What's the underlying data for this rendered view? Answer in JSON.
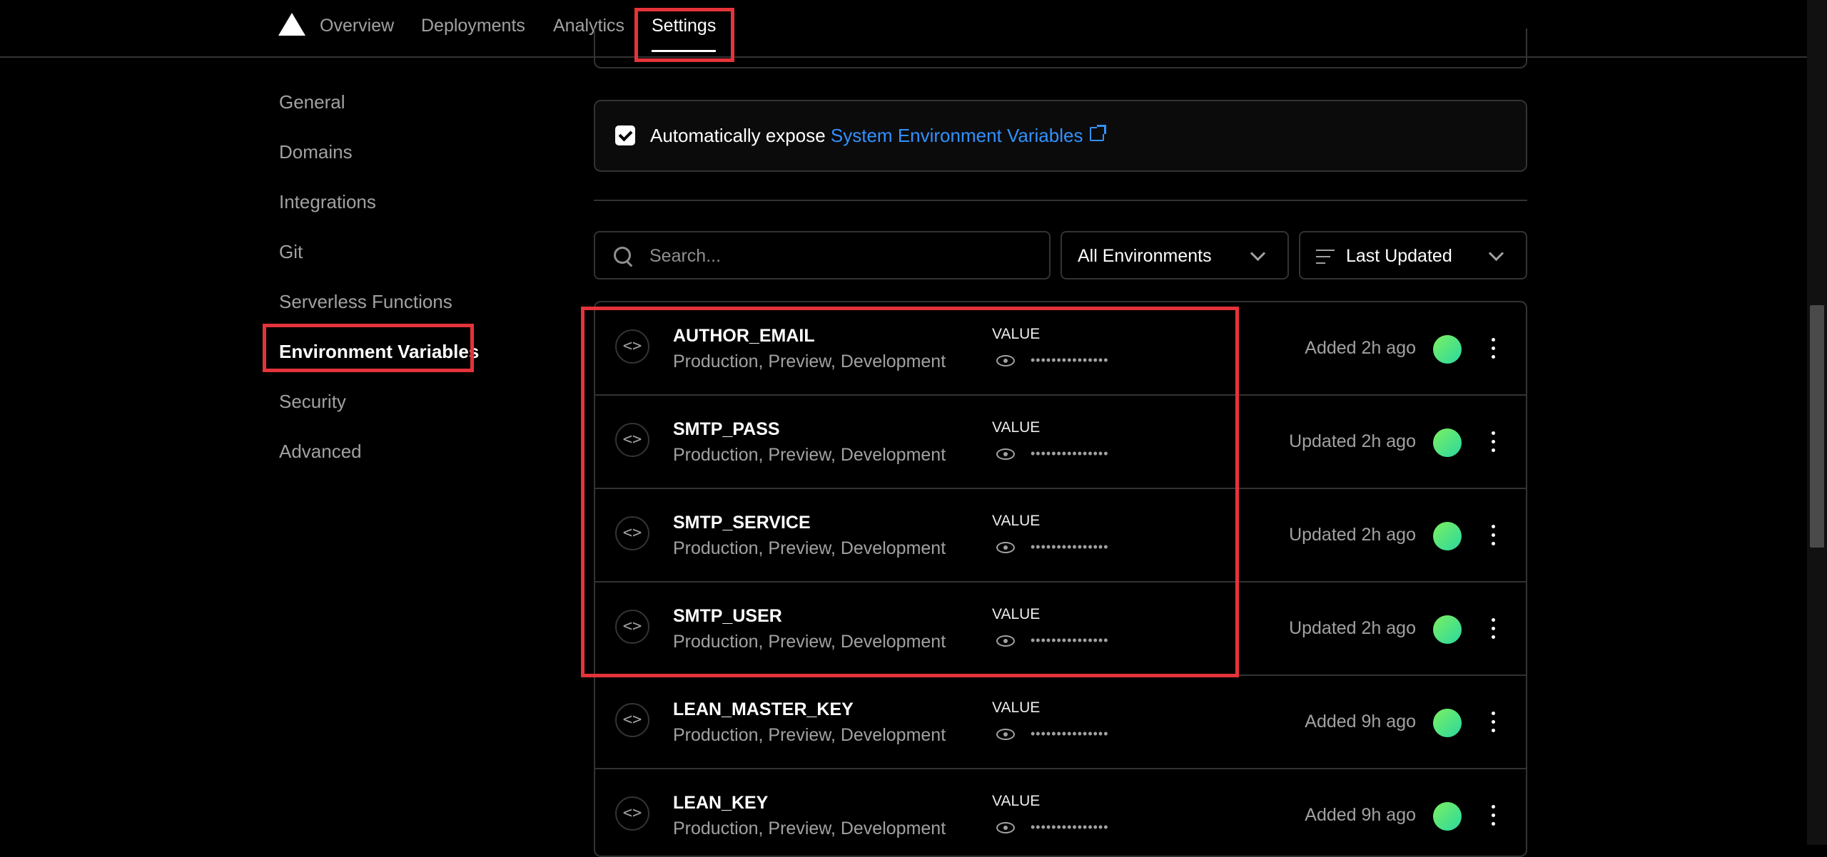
{
  "nav": {
    "tabs": [
      {
        "label": "Overview"
      },
      {
        "label": "Deployments"
      },
      {
        "label": "Analytics"
      },
      {
        "label": "Settings"
      }
    ]
  },
  "sidebar": {
    "items": [
      {
        "label": "General"
      },
      {
        "label": "Domains"
      },
      {
        "label": "Integrations"
      },
      {
        "label": "Git"
      },
      {
        "label": "Serverless Functions"
      },
      {
        "label": "Environment Variables"
      },
      {
        "label": "Security"
      },
      {
        "label": "Advanced"
      }
    ]
  },
  "expose": {
    "checked": true,
    "text": "Automatically expose ",
    "link": "System Environment Variables"
  },
  "filters": {
    "search_placeholder": "Search...",
    "environment": "All Environments",
    "sort": "Last Updated"
  },
  "env_vars": [
    {
      "name": "AUTHOR_EMAIL",
      "envs": "Production, Preview, Development",
      "value_label": "VALUE",
      "masked": "•••••••••••••••",
      "status": "Added 2h ago"
    },
    {
      "name": "SMTP_PASS",
      "envs": "Production, Preview, Development",
      "value_label": "VALUE",
      "masked": "•••••••••••••••",
      "status": "Updated 2h ago"
    },
    {
      "name": "SMTP_SERVICE",
      "envs": "Production, Preview, Development",
      "value_label": "VALUE",
      "masked": "•••••••••••••••",
      "status": "Updated 2h ago"
    },
    {
      "name": "SMTP_USER",
      "envs": "Production, Preview, Development",
      "value_label": "VALUE",
      "masked": "•••••••••••••••",
      "status": "Updated 2h ago"
    },
    {
      "name": "LEAN_MASTER_KEY",
      "envs": "Production, Preview, Development",
      "value_label": "VALUE",
      "masked": "•••••••••••••••",
      "status": "Added 9h ago"
    },
    {
      "name": "LEAN_KEY",
      "envs": "Production, Preview, Development",
      "value_label": "VALUE",
      "masked": "•••••••••••••••",
      "status": "Added 9h ago"
    }
  ],
  "colors": {
    "background": "#000000",
    "border": "#333333",
    "link": "#3291ff",
    "highlight": "#e5333a"
  }
}
